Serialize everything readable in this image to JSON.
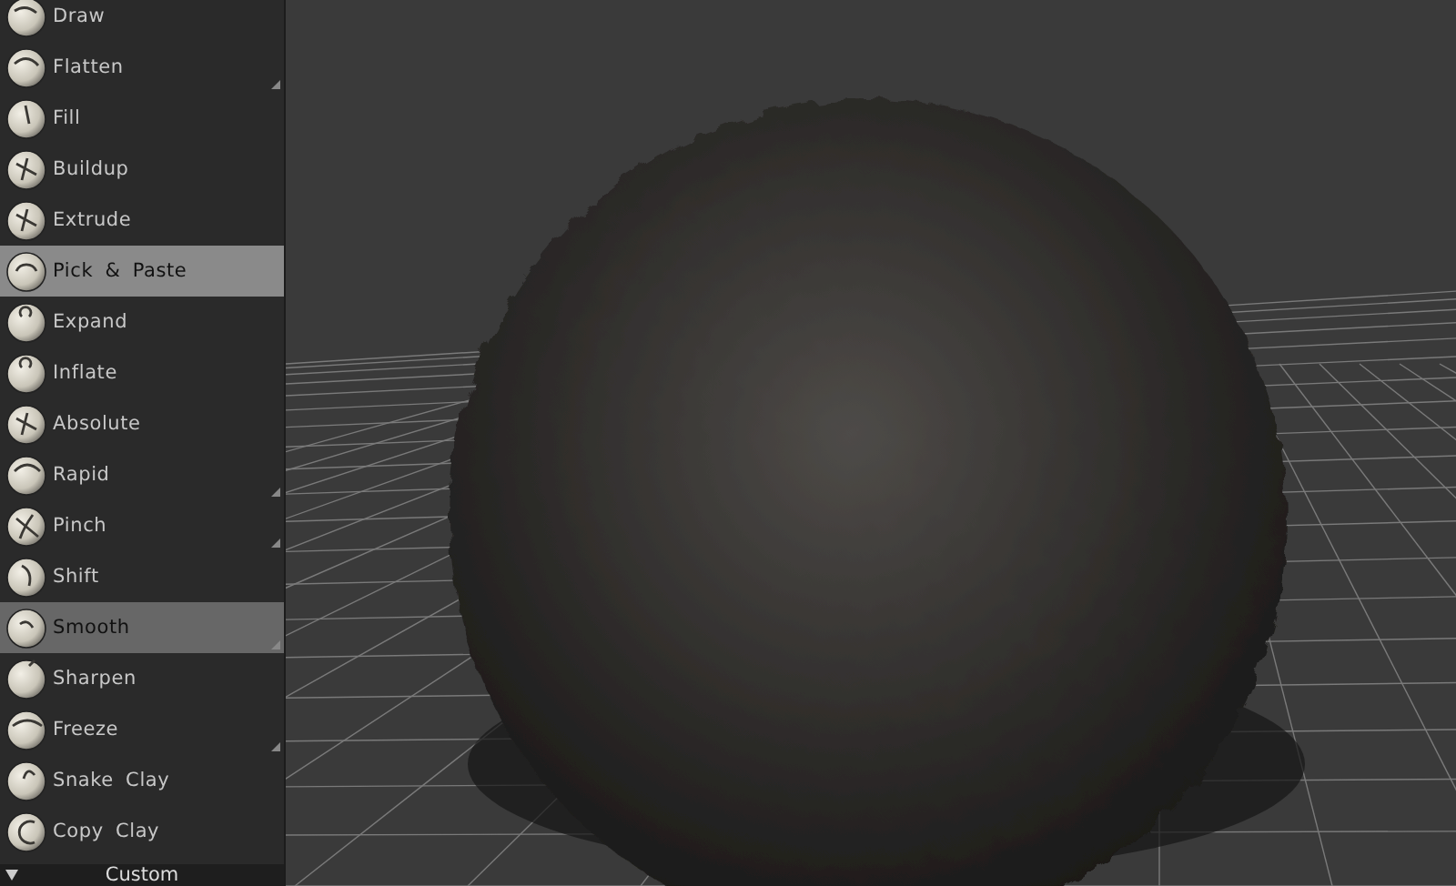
{
  "tools": [
    {
      "label": "Draw",
      "selected": false,
      "hovered": false,
      "has_submenu": false
    },
    {
      "label": "Flatten",
      "selected": false,
      "hovered": false,
      "has_submenu": true
    },
    {
      "label": "Fill",
      "selected": false,
      "hovered": false,
      "has_submenu": false
    },
    {
      "label": "Buildup",
      "selected": false,
      "hovered": false,
      "has_submenu": false
    },
    {
      "label": "Extrude",
      "selected": false,
      "hovered": false,
      "has_submenu": false
    },
    {
      "label": "Pick & Paste",
      "selected": true,
      "hovered": false,
      "has_submenu": false
    },
    {
      "label": "Expand",
      "selected": false,
      "hovered": false,
      "has_submenu": false
    },
    {
      "label": "Inflate",
      "selected": false,
      "hovered": false,
      "has_submenu": false
    },
    {
      "label": "Absolute",
      "selected": false,
      "hovered": false,
      "has_submenu": false
    },
    {
      "label": "Rapid",
      "selected": false,
      "hovered": false,
      "has_submenu": true
    },
    {
      "label": "Pinch",
      "selected": false,
      "hovered": false,
      "has_submenu": true
    },
    {
      "label": "Shift",
      "selected": false,
      "hovered": false,
      "has_submenu": false
    },
    {
      "label": "Smooth",
      "selected": false,
      "hovered": true,
      "has_submenu": true
    },
    {
      "label": "Sharpen",
      "selected": false,
      "hovered": false,
      "has_submenu": false
    },
    {
      "label": "Freeze",
      "selected": false,
      "hovered": false,
      "has_submenu": true
    },
    {
      "label": "Snake Clay",
      "selected": false,
      "hovered": false,
      "has_submenu": false
    },
    {
      "label": "Copy Clay",
      "selected": false,
      "hovered": false,
      "has_submenu": false
    }
  ],
  "section": {
    "label": "Custom",
    "expanded": true
  }
}
